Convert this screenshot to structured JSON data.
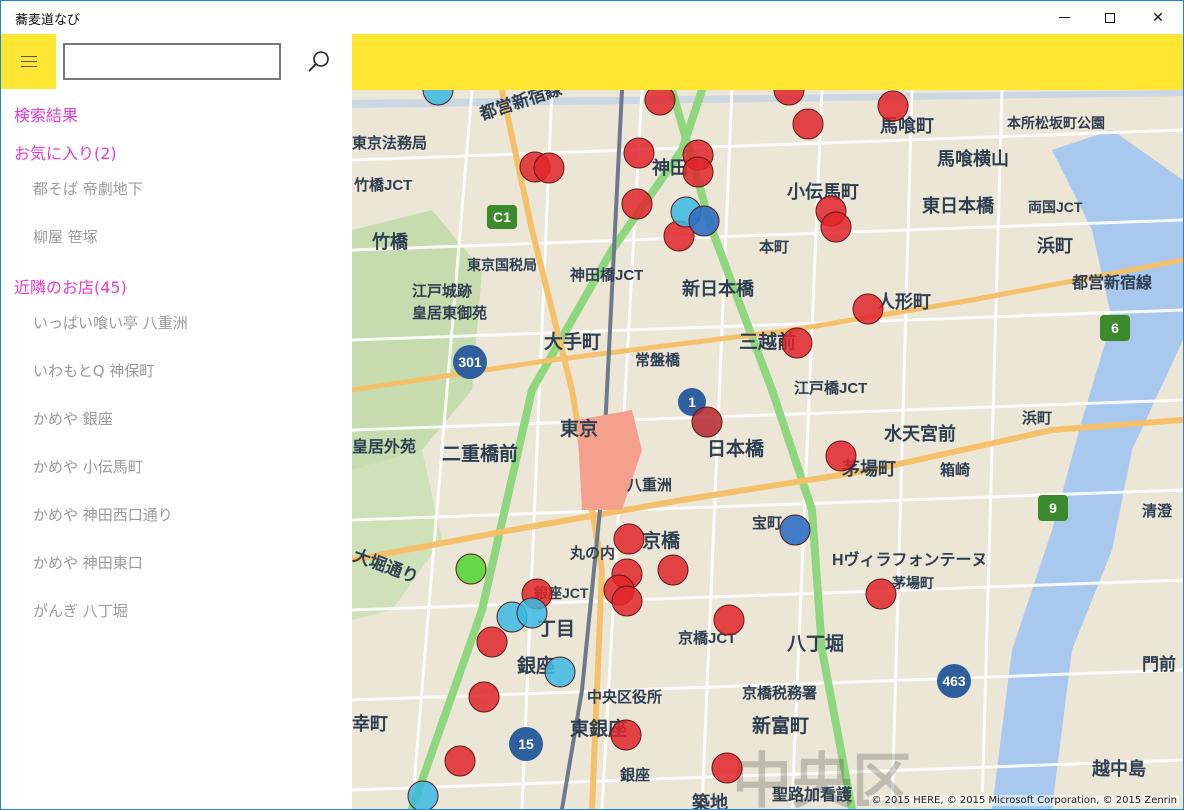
{
  "window": {
    "title": "蕎麦道なび",
    "minimize_glyph": "—",
    "close_glyph": "✕"
  },
  "search": {
    "value": "",
    "placeholder": ""
  },
  "sidebar": {
    "search_results_heading": "検索結果",
    "favorites_heading": "お気に入り(2)",
    "favorites": [
      "都そば 帝劇地下",
      "柳屋 笹塚"
    ],
    "nearby_heading": "近隣のお店(45)",
    "nearby": [
      "いっぱい喰い亭 八重洲",
      "いわもとQ 神保町",
      "かめや 銀座",
      "かめや 小伝馬町",
      "かめや 神田西口通り",
      "かめや 神田東口",
      "がんぎ 八丁堀"
    ]
  },
  "map": {
    "copyright": "© 2015 HERE, © 2015 Microsoft Corporation, © 2015 Zenrin",
    "colors": {
      "accent_yellow": "#ffe633",
      "heading_magenta": "#e53bd6",
      "marker_red": "#e0242a",
      "marker_blue": "#2f6fc4",
      "marker_cyan": "#3bb9e0",
      "marker_green": "#55d639"
    },
    "labels": {
      "toei_shinjuku_line": "都営新宿線",
      "tokyo_legal_bureau": "東京法務局",
      "takebashi_jct": "竹橋JCT",
      "takebashi": "竹橋",
      "kanda": "神田",
      "kodenmacho": "小伝馬町",
      "higashi_nihonbashi": "東日本橋",
      "bakurocho": "馬喰町",
      "bakuro_yokoyama": "馬喰横山",
      "motokura": "本所松坂町公園",
      "ryogoku_jct": "両国JCT",
      "hamacho": "浜町",
      "toei_shinjuku_line_2": "都営新宿線",
      "tokyo_tax": "東京国税局",
      "kandabashi_jct": "神田橋JCT",
      "honcho": "本町",
      "shin_nihonbashi": "新日本橋",
      "ningyocho": "人形町",
      "edo_castle": "江戸城跡",
      "east_garden": "皇居東御苑",
      "otemachi": "大手町",
      "tokiwabashi": "常盤橋",
      "mitsukoshimae": "三越前",
      "edobashi_jct": "江戸橋JCT",
      "tokyo": "東京",
      "nihonbashi": "日本橋",
      "suitengumae": "水天宮前",
      "kokyo_gaien": "皇居外苑",
      "nijubashimae": "二重橋前",
      "kayabacho": "茅場町",
      "hakozaki": "箱崎",
      "hamacho_2": "浜町",
      "yaesu": "八重洲",
      "takaracho": "宝町",
      "kyobashi": "京橋",
      "villa": "Hヴィラフォンテーヌ",
      "kayabacho_2": "茅場町",
      "marunouchi": "丸の内",
      "kiyosumi": "清澄",
      "ohori": "大堀通り",
      "ginza_jct": "銀座JCT",
      "chome": "丁目",
      "kyobashi_jct": "京橋JCT",
      "hatchobori": "八丁堀",
      "ginza": "銀座",
      "chuo_ward": "中央区役所",
      "kyobashi_tax": "京橋税務署",
      "monzen": "門前",
      "yurakucho": "幸町",
      "higashi_ginza": "東銀座",
      "shintomicho": "新富町",
      "ginza_2": "銀座",
      "etchujima": "越中島",
      "tsukiji": "築地",
      "nihonbashi_district": "中央区",
      "wide_text": "聖路加看護"
    },
    "shields": [
      "C1",
      "301",
      "1",
      "6",
      "9",
      "463",
      "15"
    ]
  }
}
